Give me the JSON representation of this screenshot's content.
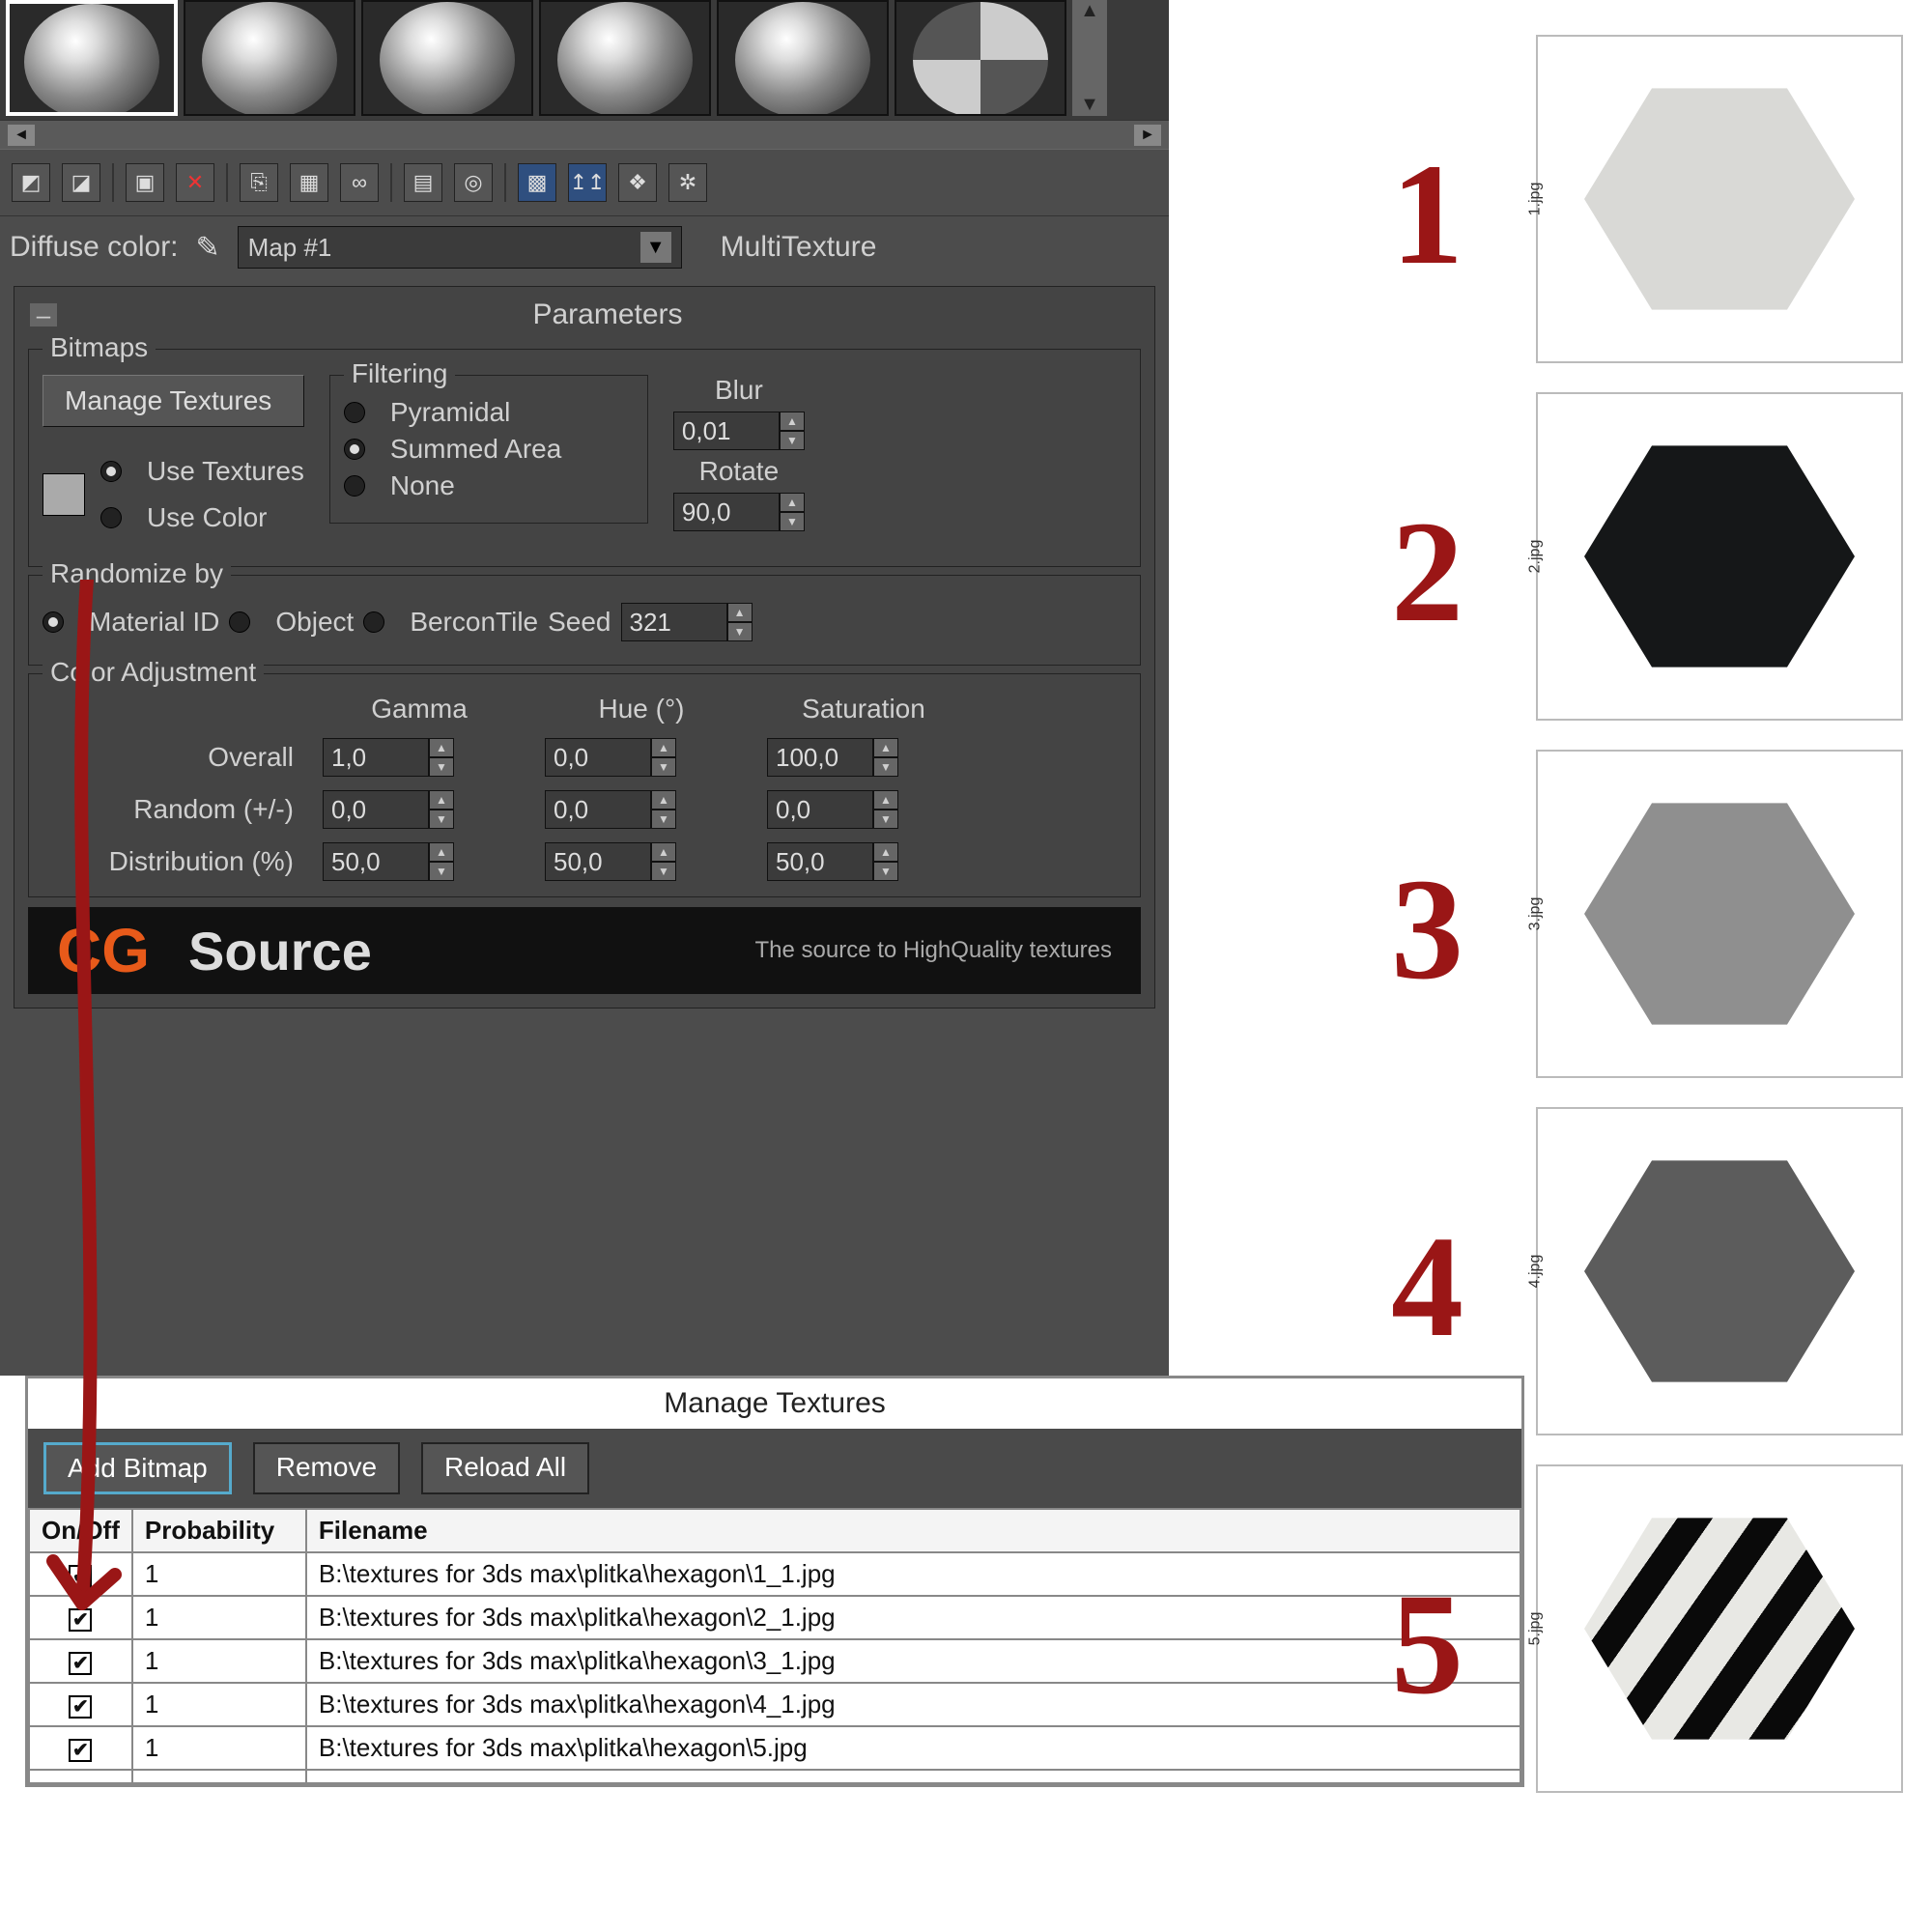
{
  "materialEditor": {
    "diffuseLabel": "Diffuse color:",
    "mapName": "Map #1",
    "mapType": "MultiTexture",
    "parametersTitle": "Parameters",
    "bitmaps": {
      "groupLabel": "Bitmaps",
      "manageBtn": "Manage Textures",
      "useTextures": "Use Textures",
      "useColor": "Use Color",
      "filtering": {
        "groupLabel": "Filtering",
        "pyramidal": "Pyramidal",
        "summedArea": "Summed Area",
        "none": "None"
      },
      "blurLabel": "Blur",
      "blurValue": "0,01",
      "rotateLabel": "Rotate",
      "rotateValue": "90,0"
    },
    "randomize": {
      "groupLabel": "Randomize by",
      "materialId": "Material ID",
      "object": "Object",
      "berconTile": "BerconTile",
      "seedLabel": "Seed",
      "seedValue": "321"
    },
    "colorAdj": {
      "groupLabel": "Color Adjustment",
      "gammaLabel": "Gamma",
      "hueLabel": "Hue (°)",
      "satLabel": "Saturation",
      "overallLabel": "Overall",
      "randomLabel": "Random (+/-)",
      "distLabel": "Distribution (%)",
      "overallGamma": "1,0",
      "overallHue": "0,0",
      "overallSat": "100,0",
      "randomGamma": "0,0",
      "randomHue": "0,0",
      "randomSat": "0,0",
      "distGamma": "50,0",
      "distHue": "50,0",
      "distSat": "50,0"
    },
    "banner": {
      "logoA": "CG",
      "logoB": "Source",
      "tag": "The source to HighQuality textures"
    }
  },
  "manageTextures": {
    "title": "Manage Textures",
    "addBitmap": "Add Bitmap",
    "remove": "Remove",
    "reloadAll": "Reload All",
    "cols": {
      "onoff": "On/Off",
      "prob": "Probability",
      "file": "Filename"
    },
    "rows": [
      {
        "on": true,
        "prob": "1",
        "file": "B:\\textures for 3ds max\\plitka\\hexagon\\1_1.jpg"
      },
      {
        "on": true,
        "prob": "1",
        "file": "B:\\textures for 3ds max\\plitka\\hexagon\\2_1.jpg"
      },
      {
        "on": true,
        "prob": "1",
        "file": "B:\\textures for 3ds max\\plitka\\hexagon\\3_1.jpg"
      },
      {
        "on": true,
        "prob": "1",
        "file": "B:\\textures for 3ds max\\plitka\\hexagon\\4_1.jpg"
      },
      {
        "on": true,
        "prob": "1",
        "file": "B:\\textures for 3ds max\\plitka\\hexagon\\5.jpg"
      }
    ]
  },
  "hex": {
    "nums": [
      "1",
      "2",
      "3",
      "4",
      "5"
    ],
    "caps": [
      "1.jpg",
      "2.jpg",
      "3.jpg",
      "4.jpg",
      "5.jpg"
    ]
  }
}
